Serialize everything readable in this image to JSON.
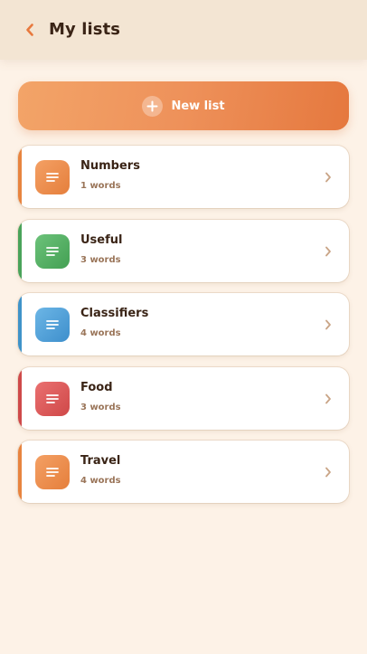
{
  "header": {
    "title": "My lists",
    "back_icon": "chevron-left-icon"
  },
  "new_list_button": {
    "label": "New list",
    "icon": "plus-icon"
  },
  "lists": [
    {
      "name": "Numbers",
      "count": "1 words",
      "color": "#ee8f4f",
      "icon": "list-icon"
    },
    {
      "name": "Useful",
      "count": "3 words",
      "color": "#4fae5f",
      "icon": "list-icon"
    },
    {
      "name": "Classifiers",
      "count": "4 words",
      "color": "#4a9fd8",
      "icon": "list-icon"
    },
    {
      "name": "Food",
      "count": "3 words",
      "color": "#dc5454",
      "icon": "list-icon"
    },
    {
      "name": "Travel",
      "count": "4 words",
      "color": "#ee8f4f",
      "icon": "list-icon"
    }
  ],
  "colors": {
    "accent": "#ee915a",
    "background": "#fdf2e7",
    "header": "#f3e5d3",
    "title_text": "#3a2416",
    "subtext": "#9a7559"
  }
}
